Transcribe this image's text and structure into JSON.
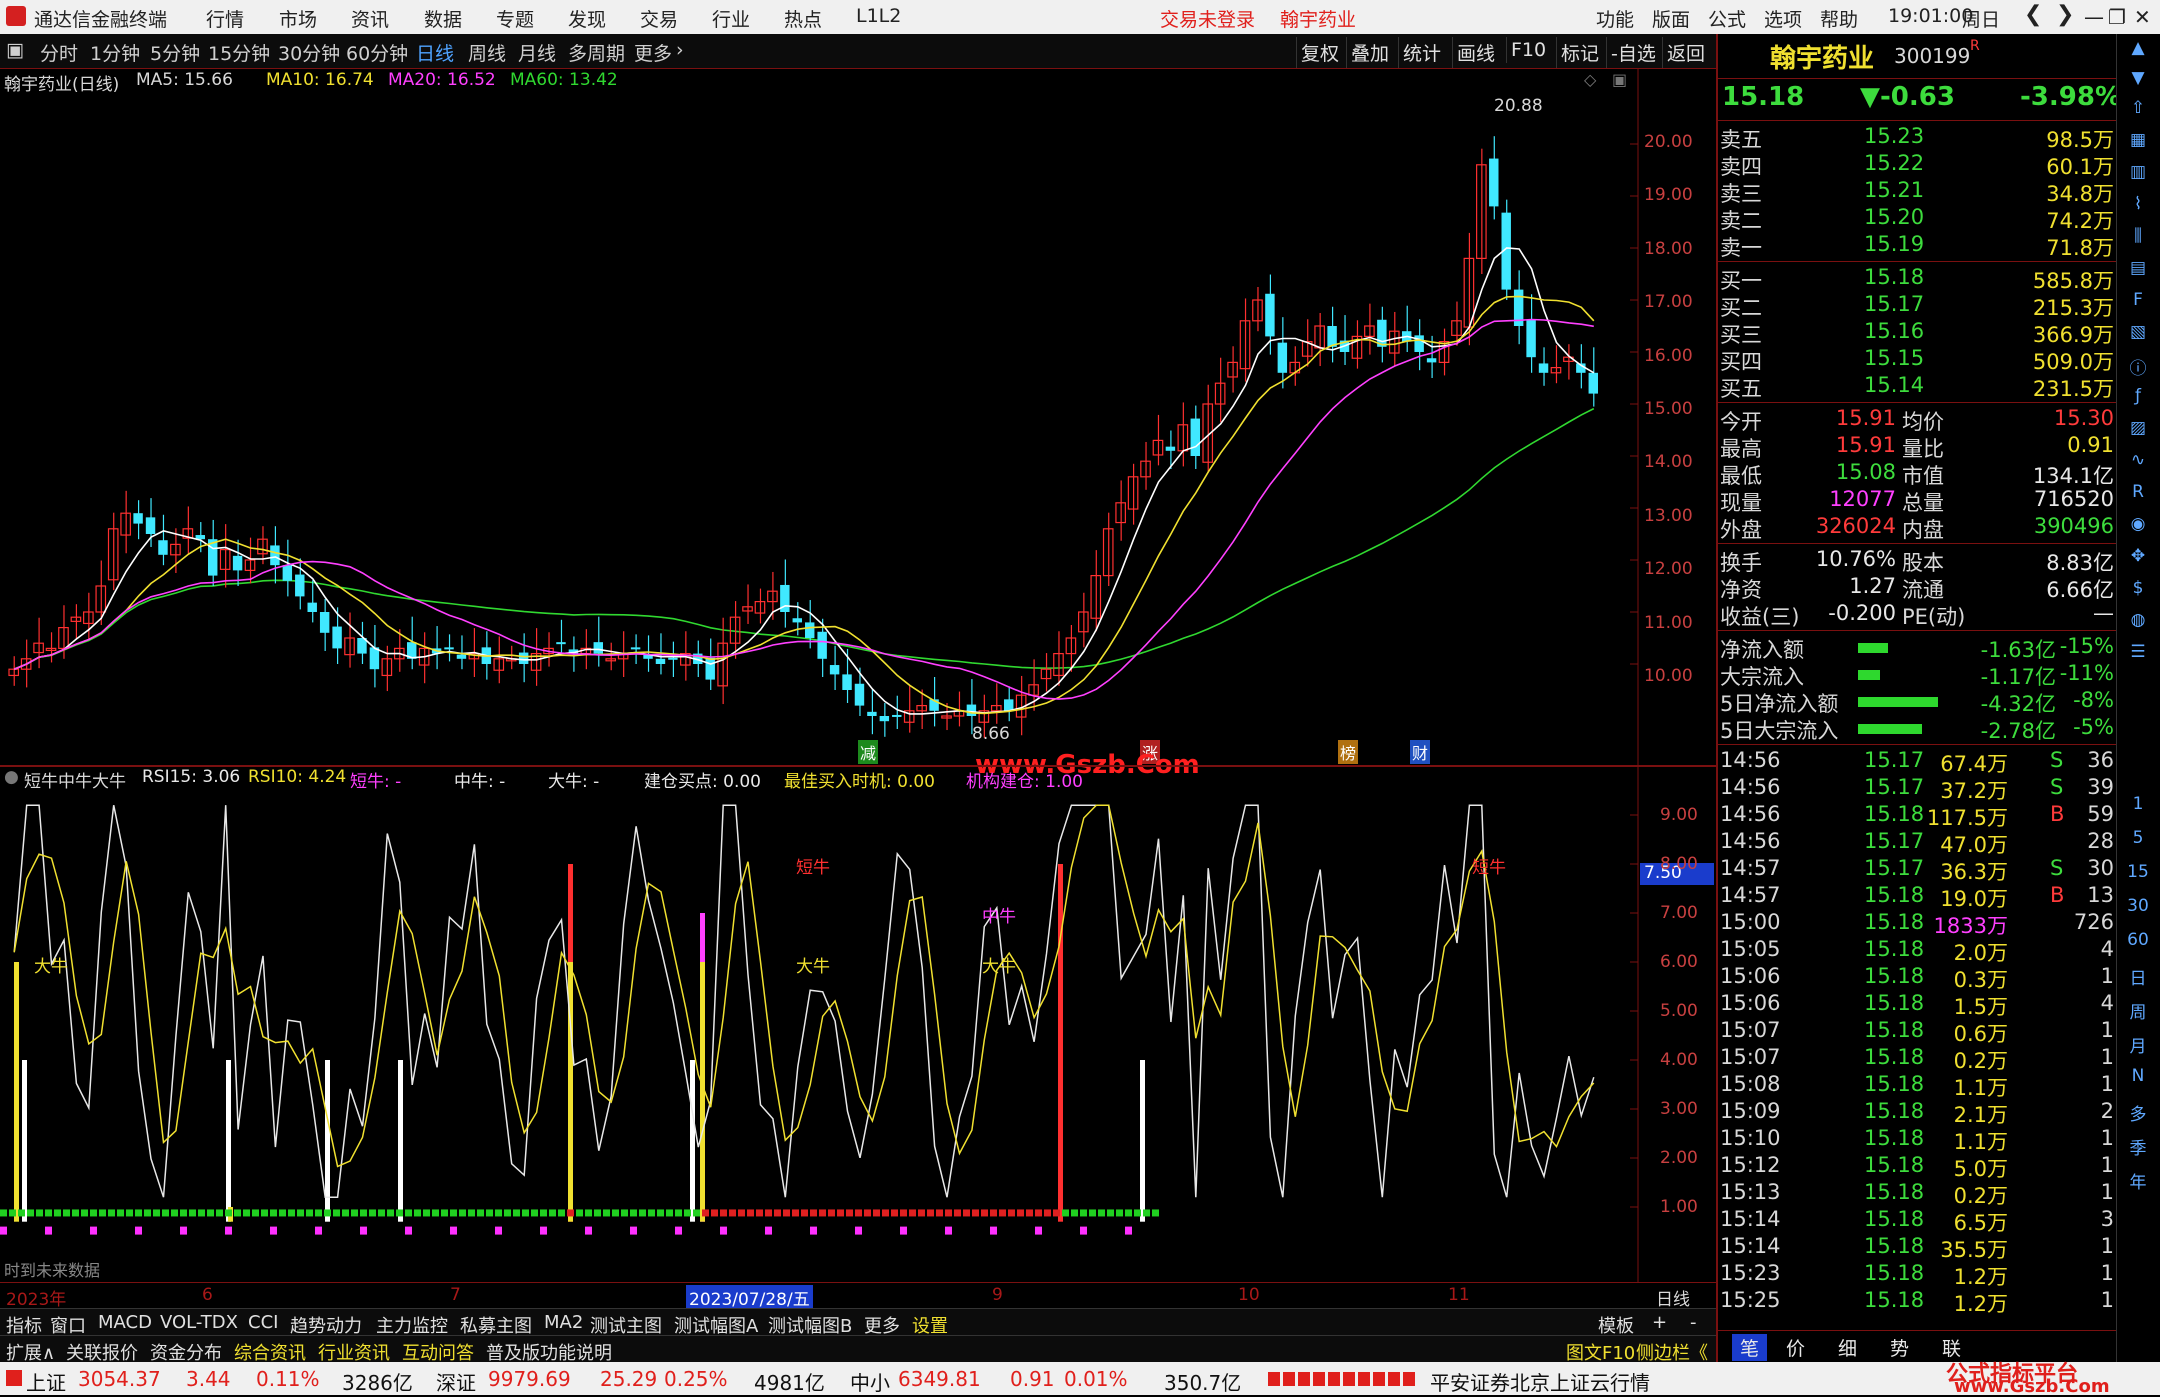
{
  "titlebar": {
    "app_name": "通达信金融终端",
    "menu": [
      "行情",
      "市场",
      "资讯",
      "数据",
      "专题",
      "发现",
      "交易",
      "行业",
      "热点",
      "L1L2"
    ],
    "trade_status": "交易未登录",
    "stock_name": "翰宇药业",
    "right_menu": [
      "功能",
      "版面",
      "公式",
      "选项",
      "帮助"
    ],
    "time": "19:01:00",
    "weekday": "周日"
  },
  "periodbar": {
    "periods": [
      "分时",
      "1分钟",
      "5分钟",
      "15分钟",
      "30分钟",
      "60分钟",
      "日线",
      "周线",
      "月线",
      "多周期",
      "更多"
    ],
    "active": "日线",
    "tools": [
      "复权",
      "叠加",
      "统计",
      "画线",
      "F10",
      "标记",
      "-自选",
      "返回"
    ]
  },
  "mainchart": {
    "title": "翰宇药业(日线)",
    "ma5_label": "MA5: 15.66",
    "ma10_label": "MA10: 16.74",
    "ma20_label": "MA20: 16.52",
    "ma60_label": "MA60: 13.42",
    "high_label": "20.88",
    "low_label": "8.66",
    "price_ticks": [
      "20.00",
      "19.00",
      "18.00",
      "17.00",
      "16.00",
      "15.00",
      "14.00",
      "13.00",
      "12.00",
      "11.00",
      "10.00"
    ],
    "event_marks": [
      "减",
      "涨",
      "榜",
      "财"
    ],
    "colors": {
      "up": "#ff3030",
      "down": "#40e8ff",
      "ma5": "#ffffff",
      "ma10": "#f0e030",
      "ma20": "#ff40ff",
      "ma60": "#30d830"
    }
  },
  "subchart": {
    "title": "短牛中牛大牛",
    "rsi15_label": "RSI15: 3.06",
    "rsi10_label": "RSI10: 4.24",
    "short_label": "短牛: -",
    "mid_label": "中牛: -",
    "big_label": "大牛: -",
    "build_label": "建仓买点: 0.00",
    "best_label": "最佳买入时机: 0.00",
    "inst_label": "机构建仓: 1.00",
    "ticks": [
      "9.00",
      "8.00",
      "7.00",
      "6.00",
      "5.00",
      "4.00",
      "3.00",
      "2.00",
      "1.00"
    ],
    "current_value": "7.50",
    "annotations": [
      "大牛",
      "短牛",
      "中牛",
      "大牛",
      "大牛",
      "短牛"
    ],
    "bottom_text": "时到未来数据"
  },
  "datebar": {
    "labels": [
      "2023年",
      "6",
      "7",
      "2023/07/28/五",
      "9",
      "10",
      "11"
    ],
    "period": "日线"
  },
  "tabbar1": {
    "tabs": [
      "指标",
      "窗口",
      "MACD",
      "VOL-TDX",
      "CCI",
      "趋势动力",
      "主力监控",
      "私募主图",
      "MA2",
      "测试主图",
      "测试幅图A",
      "测试幅图B",
      "更多",
      "设置"
    ],
    "right": [
      "模板",
      "+",
      "-"
    ]
  },
  "tabbar2": {
    "tabs": [
      "扩展∧",
      "关联报价",
      "资金分布",
      "综合资讯",
      "行业资讯",
      "互动问答",
      "普及版功能说明"
    ],
    "right": [
      "图文F10",
      "侧边栏《"
    ]
  },
  "quote": {
    "name": "翰宇药业",
    "code": "300199",
    "flag": "R",
    "price": "15.18",
    "change": "▼-0.63",
    "pct": "-3.98%",
    "asks": [
      {
        "label": "卖五",
        "p": "15.23",
        "v": "98.5万"
      },
      {
        "label": "卖四",
        "p": "15.22",
        "v": "60.1万"
      },
      {
        "label": "卖三",
        "p": "15.21",
        "v": "34.8万"
      },
      {
        "label": "卖二",
        "p": "15.20",
        "v": "74.2万"
      },
      {
        "label": "卖一",
        "p": "15.19",
        "v": "71.8万"
      }
    ],
    "bids": [
      {
        "label": "买一",
        "p": "15.18",
        "v": "585.8万"
      },
      {
        "label": "买二",
        "p": "15.17",
        "v": "215.3万"
      },
      {
        "label": "买三",
        "p": "15.16",
        "v": "366.9万"
      },
      {
        "label": "买四",
        "p": "15.15",
        "v": "509.0万"
      },
      {
        "label": "买五",
        "p": "15.14",
        "v": "231.5万"
      }
    ],
    "stats": [
      {
        "l1": "今开",
        "v1": "15.91",
        "c1": "red",
        "l2": "均价",
        "v2": "15.30",
        "c2": "red"
      },
      {
        "l1": "最高",
        "v1": "15.91",
        "c1": "red",
        "l2": "量比",
        "v2": "0.91",
        "c2": "yel"
      },
      {
        "l1": "最低",
        "v1": "15.08",
        "c1": "grn",
        "l2": "市值",
        "v2": "134.1亿",
        "c2": "wht"
      },
      {
        "l1": "现量",
        "v1": "12077",
        "c1": "mag",
        "l2": "总量",
        "v2": "716520",
        "c2": "wht"
      },
      {
        "l1": "外盘",
        "v1": "326024",
        "c1": "red",
        "l2": "内盘",
        "v2": "390496",
        "c2": "grn"
      }
    ],
    "stats2": [
      {
        "l1": "换手",
        "v1": "10.76%",
        "l2": "股本",
        "v2": "8.83亿"
      },
      {
        "l1": "净资",
        "v1": "1.27",
        "l2": "流通",
        "v2": "6.66亿"
      },
      {
        "l1": "收益(三)",
        "v1": "-0.200",
        "l2": "PE(动)",
        "v2": "—"
      }
    ],
    "flows": [
      {
        "label": "净流入额",
        "value": "-1.63亿",
        "pct": "-15%",
        "fill": 0.15
      },
      {
        "label": "大宗流入",
        "value": "-1.17亿",
        "pct": "-11%",
        "fill": 0.11
      },
      {
        "label": "5日净流入额",
        "value": "-4.32亿",
        "pct": "-8%",
        "fill": 0.4
      },
      {
        "label": "5日大宗流入",
        "value": "-2.78亿",
        "pct": "-5%",
        "fill": 0.32
      }
    ],
    "ticks": [
      {
        "t": "14:56",
        "p": "15.17",
        "v": "67.4万",
        "bs": "S",
        "n": "36"
      },
      {
        "t": "14:56",
        "p": "15.17",
        "v": "37.2万",
        "bs": "S",
        "n": "39"
      },
      {
        "t": "14:56",
        "p": "15.18",
        "v": "117.5万",
        "bs": "B",
        "n": "59"
      },
      {
        "t": "14:56",
        "p": "15.17",
        "v": "47.0万",
        "bs": "",
        "n": "28"
      },
      {
        "t": "14:57",
        "p": "15.17",
        "v": "36.3万",
        "bs": "S",
        "n": "30"
      },
      {
        "t": "14:57",
        "p": "15.18",
        "v": "19.0万",
        "bs": "B",
        "n": "13"
      },
      {
        "t": "15:00",
        "p": "15.18",
        "v": "1833万",
        "bs": "",
        "n": "726"
      },
      {
        "t": "15:05",
        "p": "15.18",
        "v": "2.0万",
        "bs": "",
        "n": "4"
      },
      {
        "t": "15:06",
        "p": "15.18",
        "v": "0.3万",
        "bs": "",
        "n": "1"
      },
      {
        "t": "15:06",
        "p": "15.18",
        "v": "1.5万",
        "bs": "",
        "n": "4"
      },
      {
        "t": "15:07",
        "p": "15.18",
        "v": "0.6万",
        "bs": "",
        "n": "1"
      },
      {
        "t": "15:07",
        "p": "15.18",
        "v": "0.2万",
        "bs": "",
        "n": "1"
      },
      {
        "t": "15:08",
        "p": "15.18",
        "v": "1.1万",
        "bs": "",
        "n": "1"
      },
      {
        "t": "15:09",
        "p": "15.18",
        "v": "2.1万",
        "bs": "",
        "n": "2"
      },
      {
        "t": "15:10",
        "p": "15.18",
        "v": "1.1万",
        "bs": "",
        "n": "1"
      },
      {
        "t": "15:12",
        "p": "15.18",
        "v": "5.0万",
        "bs": "",
        "n": "1"
      },
      {
        "t": "15:13",
        "p": "15.18",
        "v": "0.2万",
        "bs": "",
        "n": "1"
      },
      {
        "t": "15:14",
        "p": "15.18",
        "v": "6.5万",
        "bs": "",
        "n": "3"
      },
      {
        "t": "15:14",
        "p": "15.18",
        "v": "35.5万",
        "bs": "",
        "n": "1"
      },
      {
        "t": "15:23",
        "p": "15.18",
        "v": "1.2万",
        "bs": "",
        "n": "1"
      },
      {
        "t": "15:25",
        "p": "15.18",
        "v": "1.2万",
        "bs": "",
        "n": "1"
      }
    ],
    "bottom_tabs": [
      "笔",
      "价",
      "细",
      "势",
      "联"
    ]
  },
  "toolstrip": [
    "1",
    "5",
    "15",
    "30",
    "60",
    "日",
    "周",
    "月",
    "N",
    "多",
    "季",
    "年"
  ],
  "statusbar": {
    "sh_label": "上证",
    "sh_value": "3054.37",
    "sh_chg": "3.44",
    "sh_pct": "0.11%",
    "sh_amt": "3286亿",
    "sz_label": "深证",
    "sz_value": "9979.69",
    "sz_chg": "25.29",
    "sz_pct": "0.25%",
    "sz_amt": "4981亿",
    "zx_label": "中小",
    "zx_value": "6349.81",
    "zx_chg": "0.91",
    "zx_pct": "0.01%",
    "zx_amt": "350.7亿",
    "broker": "平安证券北京上证云行情"
  },
  "watermark": {
    "site": "www.Gszb.Com",
    "platform": "公式指标平台",
    "platform_url": "www.Gszb.Com"
  }
}
